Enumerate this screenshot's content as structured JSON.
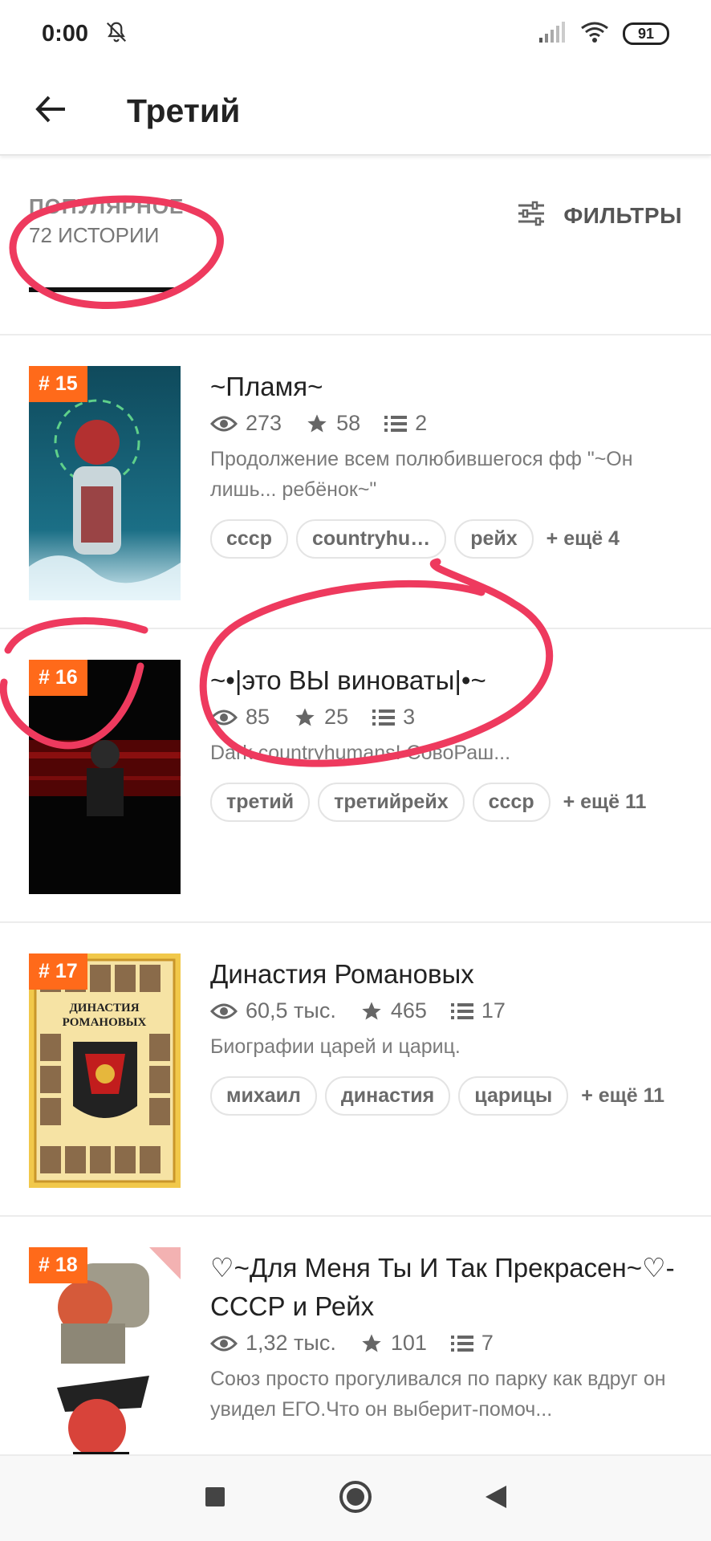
{
  "status_bar": {
    "time": "0:00",
    "battery": "91",
    "icons": [
      "bell-off-icon",
      "signal-icon",
      "wifi-icon",
      "battery-icon"
    ]
  },
  "app_bar": {
    "title": "Третий",
    "back_icon": "arrow-left-icon"
  },
  "filter_bar": {
    "sort_label": "ПОПУЛЯРНОЕ",
    "count_label": "72 ИСТОРИИ",
    "filters_label": "ФИЛЬТРЫ",
    "filters_icon": "sliders-icon"
  },
  "colors": {
    "accent": "#ff6a1a",
    "scribble": "#ee3a5e"
  },
  "stories": [
    {
      "rank": "# 15",
      "title": "~Пламя~",
      "views": "273",
      "votes": "58",
      "parts": "2",
      "description": "Продолжение всем полюбившегося фф \"~Он лишь... ребёнок~\"",
      "tags": [
        "ссср",
        "countryhu…",
        "рейх"
      ],
      "more": "+ ещё 4"
    },
    {
      "rank": "# 16",
      "title": "~•|это ВЫ виноваты|•~",
      "views": "85",
      "votes": "25",
      "parts": "3",
      "description": "Dark countryhumans! СовоРаш...",
      "tags": [
        "третий",
        "третийрейх",
        "ссср"
      ],
      "more": "+ ещё 11"
    },
    {
      "rank": "# 17",
      "title": "Династия Романовых",
      "views": "60,5 тыс.",
      "votes": "465",
      "parts": "17",
      "description": "Биографии царей и цариц.",
      "tags": [
        "михаил",
        "династия",
        "царицы"
      ],
      "more": "+ ещё 11"
    },
    {
      "rank": "# 18",
      "title": "♡~Для Меня Ты И Так Прекрасен~♡-СССР и  Рейх",
      "views": "1,32 тыс.",
      "votes": "101",
      "parts": "7",
      "description": "Союз просто прогуливался по парку как вдруг он увидел ЕГО.Что он выберит-помоч...",
      "tags": [],
      "more": ""
    }
  ],
  "cover_texts": {
    "romanov_line1": "ДИНАСТИЯ",
    "romanov_line2": "РОМАНОВЫХ"
  },
  "nav_bar": {
    "icons": [
      "square-recents-icon",
      "circle-home-icon",
      "triangle-back-icon"
    ]
  }
}
